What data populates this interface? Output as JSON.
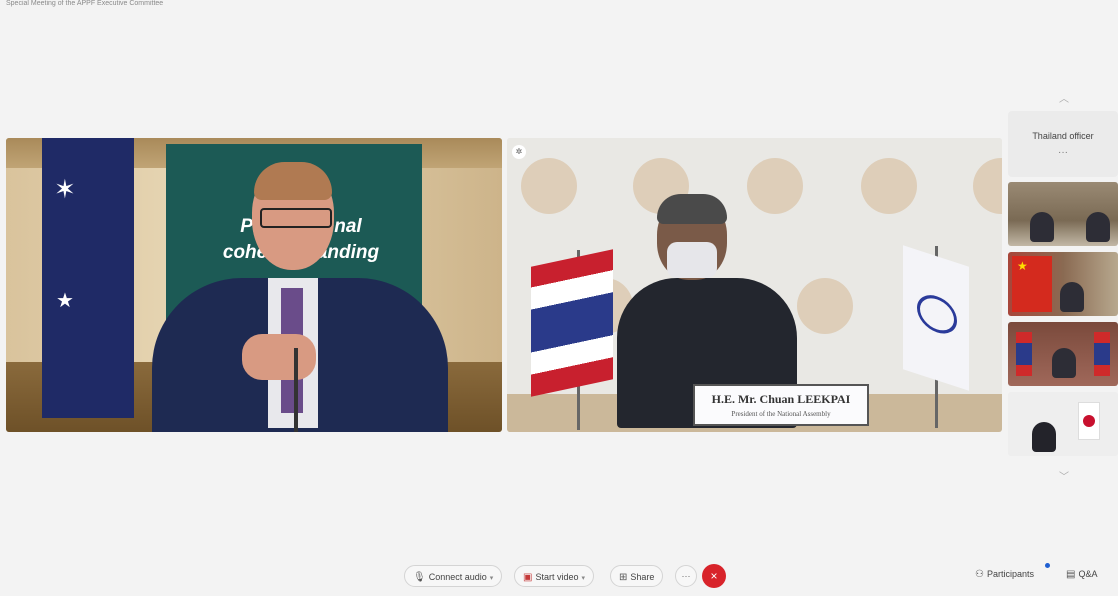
{
  "meeting": {
    "title": "Special Meeting of the APPF Executive Committee"
  },
  "stage": {
    "left_tile": {
      "banner_line1": "Promo      gional",
      "banner_line2": "cohesio      standing"
    },
    "right_tile": {
      "nameplate_name": "H.E. Mr. Chuan LEEKPAI",
      "nameplate_role": "President of the National Assembly"
    }
  },
  "sidebar": {
    "text_participant": {
      "name": "Thailand officer",
      "more": "···"
    },
    "thumbnail_count": 4
  },
  "toolbar": {
    "connect_audio": "Connect audio",
    "start_video": "Start video",
    "share": "Share",
    "more": "···",
    "leave": "×",
    "participants": "Participants",
    "qa": "Q&A"
  },
  "icons": {
    "mic": "microphone-icon",
    "video": "camera-icon",
    "share": "share-icon",
    "participants": "participants-icon",
    "qa": "qa-icon",
    "leave": "close-icon",
    "pin": "pin-icon"
  },
  "colors": {
    "leave_red": "#d8232a",
    "notification_blue": "#1f5fd1"
  }
}
